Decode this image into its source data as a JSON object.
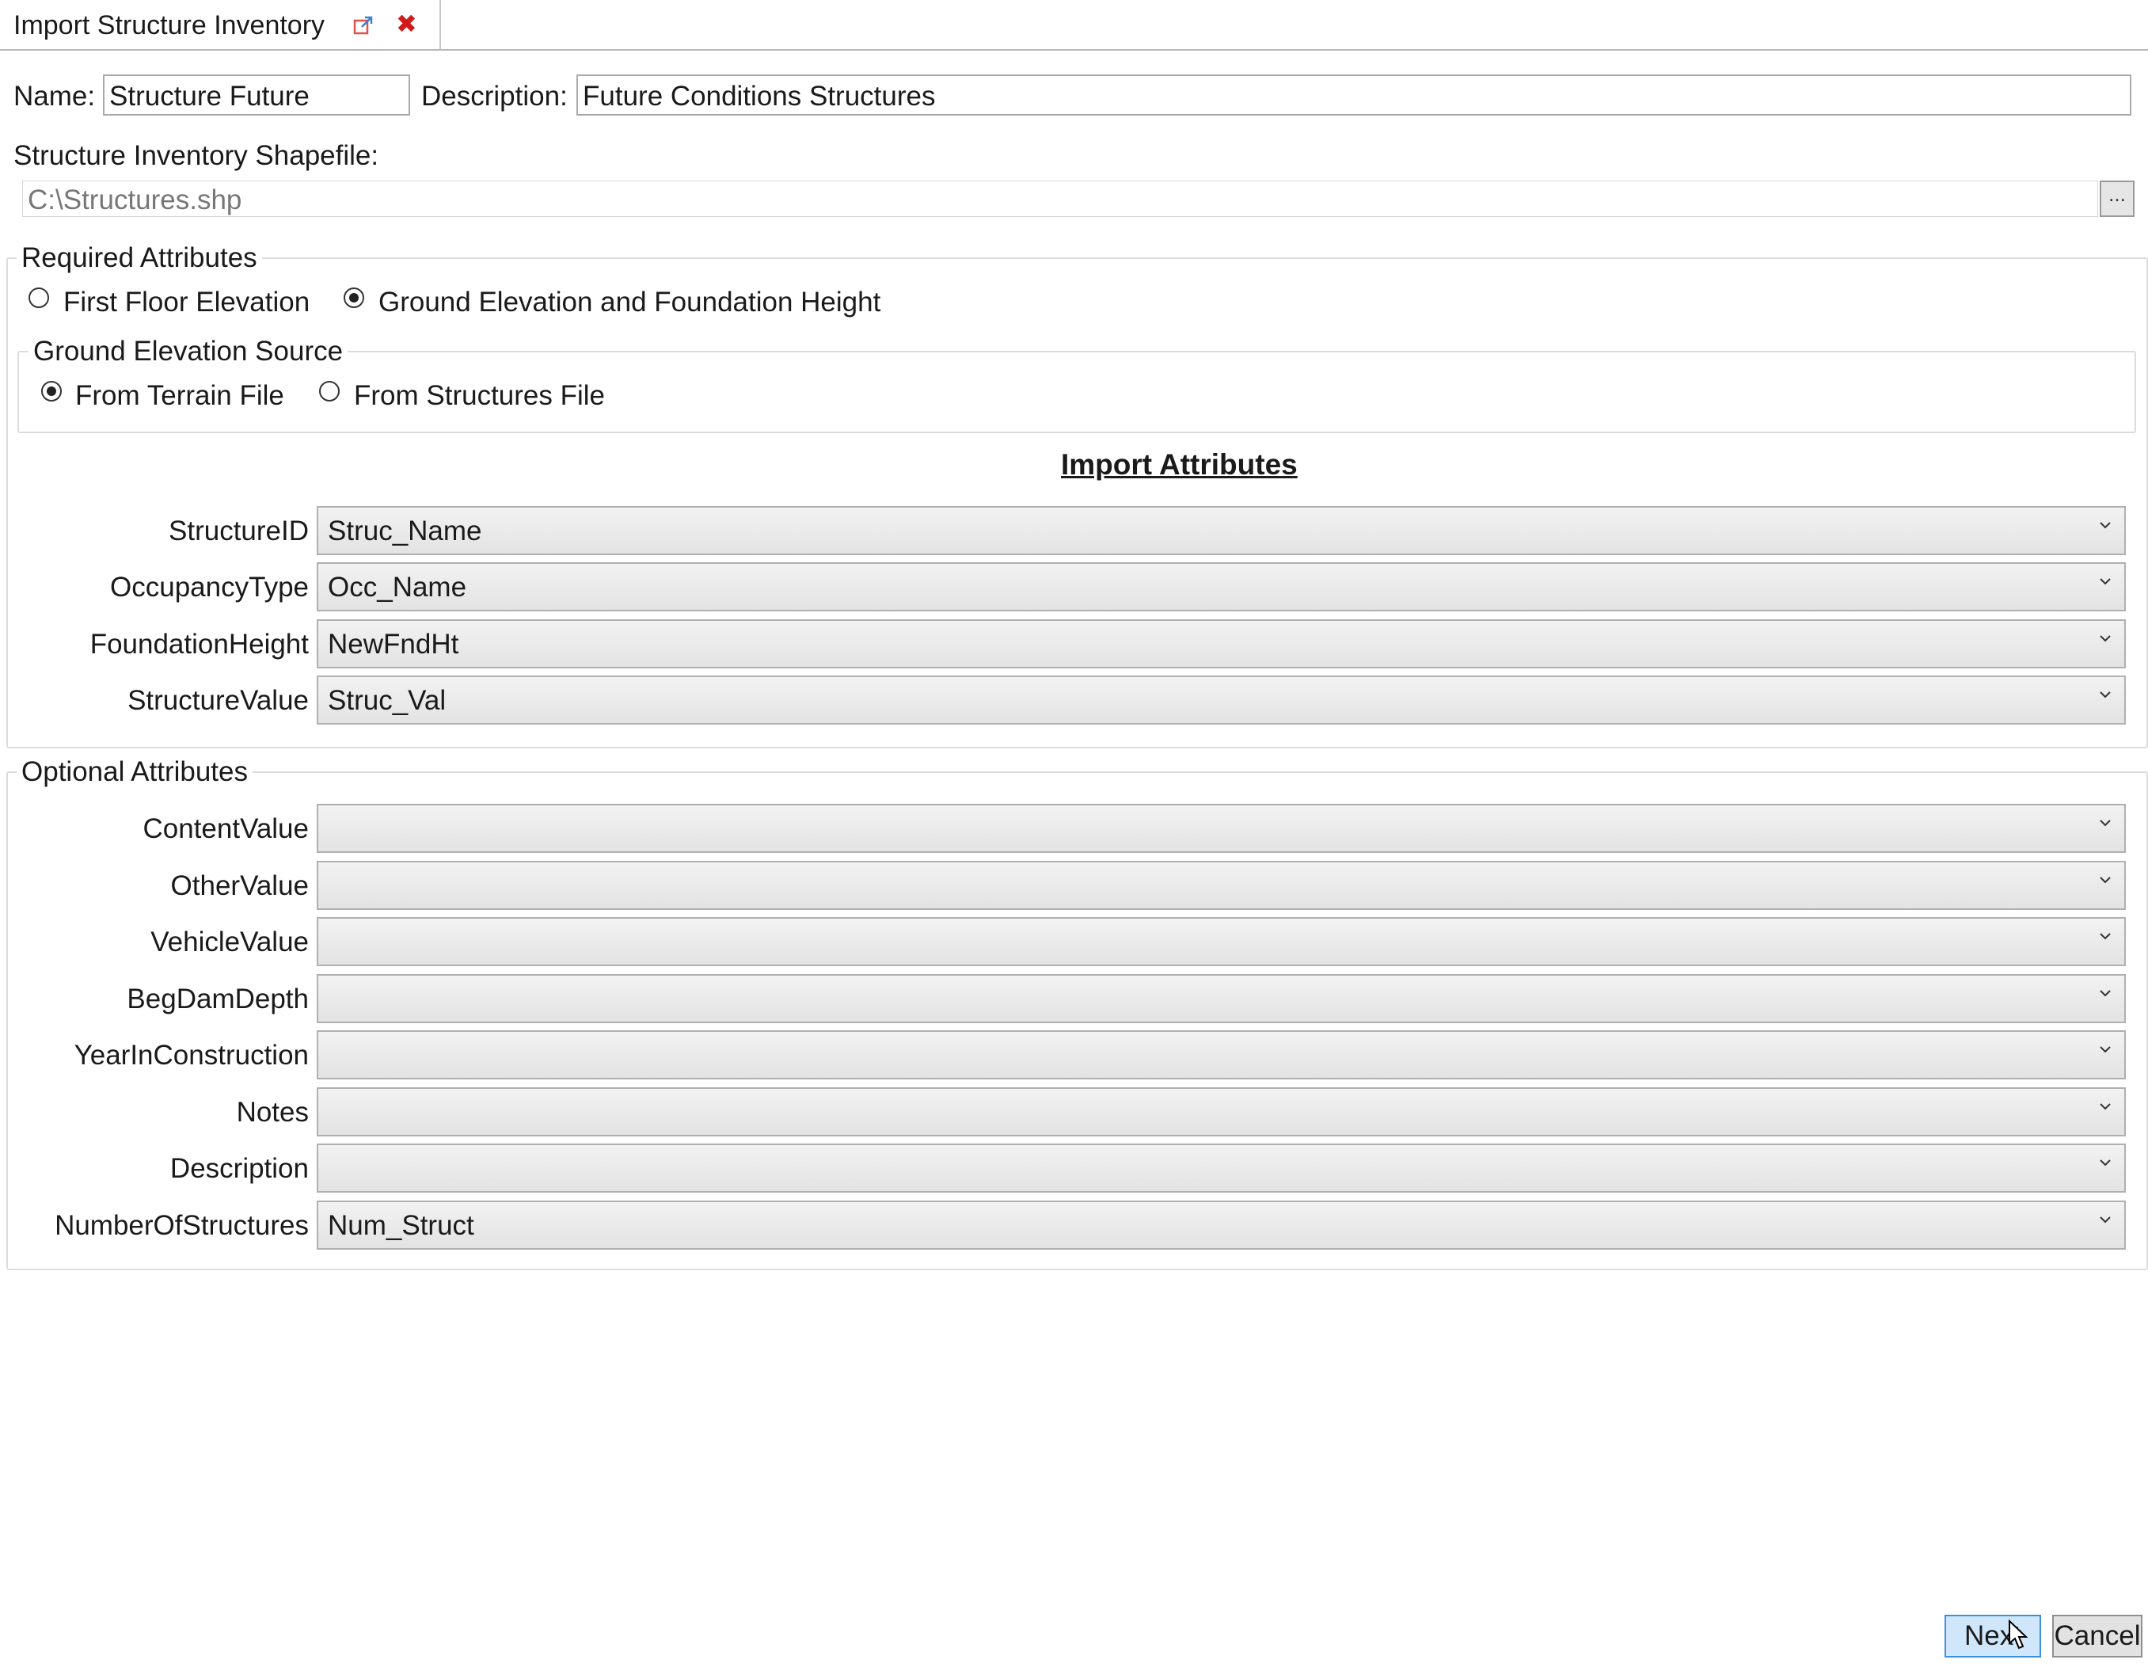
{
  "window": {
    "tab_title": "Import Structure Inventory",
    "popout_icon": "popout-icon",
    "close_icon": "close-icon"
  },
  "form": {
    "name_label": "Name:",
    "name_value": "Structure Future",
    "description_label": "Description:",
    "description_value": "Future Conditions Structures",
    "shapefile_label": "Structure Inventory Shapefile:",
    "shapefile_value": "C:\\Structures.shp",
    "browse_label": "..."
  },
  "required": {
    "legend": "Required Attributes",
    "option_first_floor": "First Floor Elevation",
    "option_ground_elev": "Ground Elevation and Foundation Height",
    "selected": "ground_elev",
    "ground_source": {
      "legend": "Ground Elevation Source",
      "option_terrain": "From Terrain File",
      "option_structures": "From Structures File",
      "selected": "terrain"
    },
    "import_title": "Import Attributes",
    "rows": [
      {
        "label": "StructureID",
        "value": "Struc_Name"
      },
      {
        "label": "OccupancyType",
        "value": "Occ_Name"
      },
      {
        "label": "FoundationHeight",
        "value": "NewFndHt"
      },
      {
        "label": "StructureValue",
        "value": "Struc_Val"
      }
    ]
  },
  "optional": {
    "legend": "Optional Attributes",
    "rows": [
      {
        "label": "ContentValue",
        "value": ""
      },
      {
        "label": "OtherValue",
        "value": ""
      },
      {
        "label": "VehicleValue",
        "value": ""
      },
      {
        "label": "BegDamDepth",
        "value": ""
      },
      {
        "label": "YearInConstruction",
        "value": ""
      },
      {
        "label": "Notes",
        "value": ""
      },
      {
        "label": "Description",
        "value": ""
      },
      {
        "label": "NumberOfStructures",
        "value": "Num_Struct"
      }
    ]
  },
  "footer": {
    "next_label": "Next",
    "cancel_label": "Cancel"
  },
  "colors": {
    "close_red": "#d11a1a",
    "primary_button": "#cfe6fb",
    "primary_border": "#3c8fd8"
  }
}
